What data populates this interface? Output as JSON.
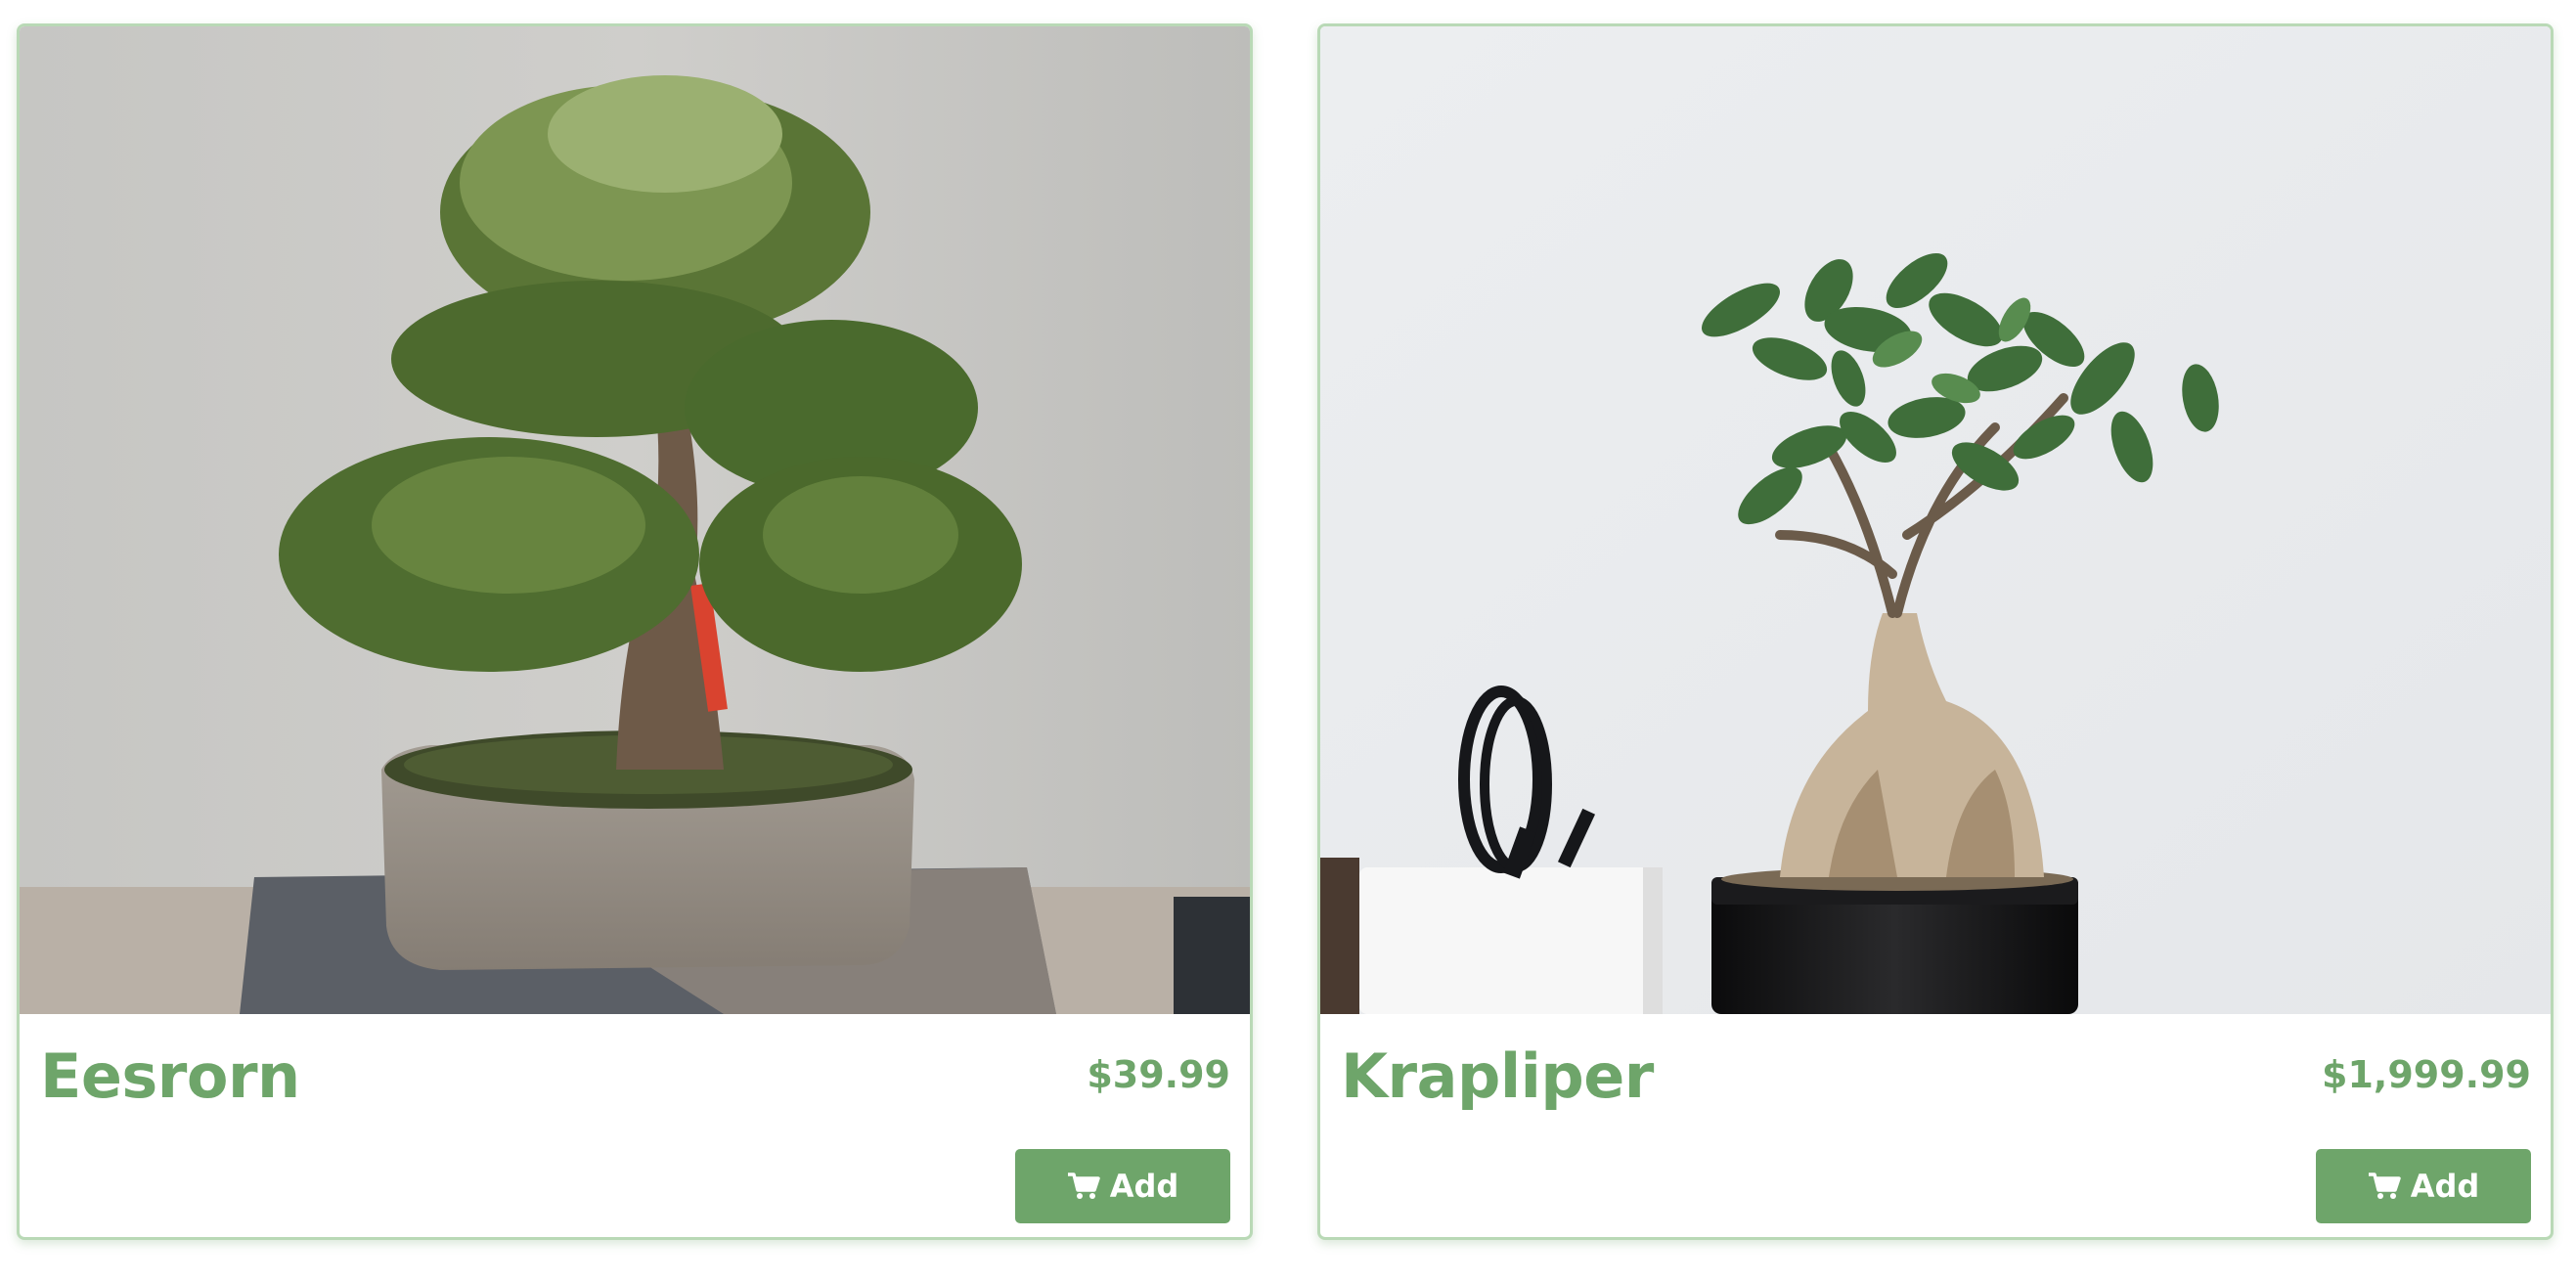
{
  "products": [
    {
      "name": "Eesrorn",
      "price": "$39.99",
      "button_label": "Add",
      "button_icon": "cart-icon",
      "image": "bonsai juniper tree in grey ceramic pot on wooden stand"
    },
    {
      "name": "Krapliper",
      "price": "$1,999.99",
      "button_label": "Add",
      "button_icon": "cart-icon",
      "image": "ginseng ficus bonsai in black glossy pot beside white cup"
    }
  ],
  "colors": {
    "accent": "#6ea56a",
    "card_border": "#b9d9b6",
    "button_text": "#ffffff"
  }
}
